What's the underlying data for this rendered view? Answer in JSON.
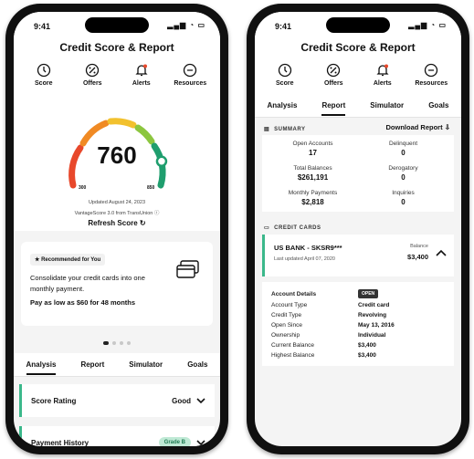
{
  "status_time": "9:41",
  "app_title": "Credit Score & Report",
  "actions": [
    {
      "label": "Score",
      "icon": "score-icon"
    },
    {
      "label": "Offers",
      "icon": "offers-icon"
    },
    {
      "label": "Alerts",
      "icon": "bell-icon"
    },
    {
      "label": "Resources",
      "icon": "resources-icon"
    }
  ],
  "score": {
    "value": "760",
    "min": "300",
    "max": "850",
    "updated": "Updated August 24, 2023",
    "source": "VantageScore 3.0 from TransUnion",
    "refresh_label": "Refresh Score",
    "fraction": 0.84
  },
  "promo": {
    "tag": "Recommended for You",
    "body": "Consolidate your credit cards into one monthly payment.",
    "offer": "Pay as low as $60 for 48 months"
  },
  "tabs": [
    "Analysis",
    "Report",
    "Simulator",
    "Goals"
  ],
  "left_accordions": [
    {
      "label": "Score Rating",
      "value": "Good"
    },
    {
      "label": "Payment History",
      "value": "Grade B"
    }
  ],
  "report": {
    "summary_label": "SUMMARY",
    "download_label": "Download Report",
    "summary": [
      {
        "label": "Open Accounts",
        "value": "17"
      },
      {
        "label": "Delinquent",
        "value": "0"
      },
      {
        "label": "Total Balances",
        "value": "$261,191"
      },
      {
        "label": "Derogatory",
        "value": "0"
      },
      {
        "label": "Monthly Payments",
        "value": "$2,818"
      },
      {
        "label": "Inquiries",
        "value": "0"
      }
    ],
    "credit_cards_label": "CREDIT CARDS",
    "card": {
      "name": "US BANK - SKSR9***",
      "updated": "Last updated April 07, 2020",
      "balance_label": "Balance",
      "balance": "$3,400"
    },
    "details_title": "Account Details",
    "details_badge": "OPEN",
    "details": [
      {
        "label": "Account Type",
        "value": "Credit card"
      },
      {
        "label": "Credit Type",
        "value": "Revolving"
      },
      {
        "label": "Open Since",
        "value": "May 13, 2016"
      },
      {
        "label": "Ownership",
        "value": "Individual"
      },
      {
        "label": "Current Balance",
        "value": "$3,400"
      },
      {
        "label": "Highest Balance",
        "value": "$3,400"
      }
    ]
  },
  "colors": {
    "accent": "#3bb88b",
    "gauge": [
      "#e8482b",
      "#f08a24",
      "#f2c12e",
      "#8cc63f",
      "#1f9e6e"
    ]
  }
}
